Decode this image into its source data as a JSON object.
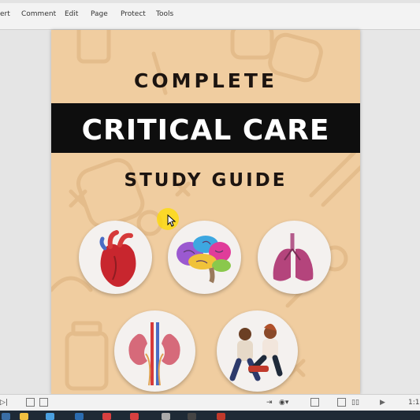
{
  "menu": {
    "items": [
      "ert",
      "Comment",
      "Edit",
      "Page",
      "Protect",
      "Tools"
    ]
  },
  "document": {
    "title_line1": "COMPLETE",
    "title_line2": "CRITICAL CARE",
    "title_line3": "STUDY GUIDE",
    "images": [
      "heart-icon",
      "brain-icon",
      "lungs-icon",
      "kidneys-icon",
      "first-aid-people-icon"
    ]
  },
  "status_bar": {
    "page_indicator": "1:1"
  },
  "colors": {
    "page_bg": "#f0cda0",
    "banner": "#0e0e0e",
    "title_text": "#1c1410"
  }
}
